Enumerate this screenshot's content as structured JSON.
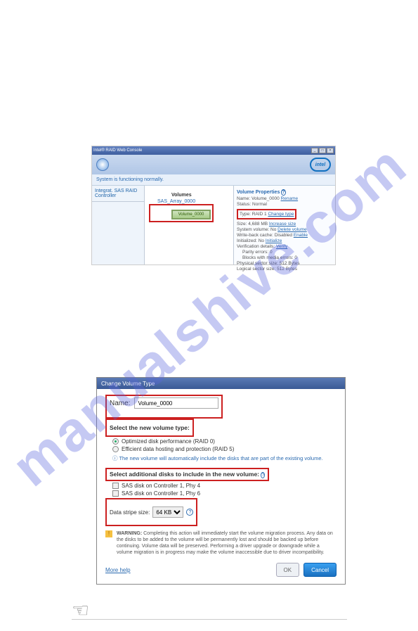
{
  "watermark": "manualshive.com",
  "shot1": {
    "titlebar": "Intel® RAID Web Console",
    "win_min": "_",
    "win_max": "□",
    "win_close": "×",
    "intel_logo": "intel",
    "status": "System is functioning normally.",
    "tab_label": "Integrat. SAS RAID Controller",
    "volumes_header": "Volumes",
    "array_name": "SAS_Array_0000",
    "volume_chip": "Volume_0000",
    "props_title": "Volume Properties",
    "name_line": "Name: Volume_0000",
    "name_link": "Rename",
    "status_line": "Status: Normal",
    "type_line": "Type: RAID 1",
    "type_link": "Change type",
    "size_line": "Size: 4,688 MB",
    "size_link": "Increase size",
    "sysvol_line": "System volume: No",
    "sysvol_link": "Delete volume",
    "wbc_line": "Write-back cache: Disabled",
    "wbc_link": "Enable",
    "init_line": "Initialized: No",
    "init_link": "Initialize",
    "verify_line": "Verification details:",
    "verify_link": "Verify",
    "parity_line": "Parity errors: 0",
    "blocks_line": "Blocks with media errors: 0",
    "physsec_line": "Physical sector size: 512 Bytes",
    "logsec_line": "Logical sector size: 512 Bytes"
  },
  "dlg": {
    "title": "Change Volume Type",
    "name_label": "Name:",
    "name_value": "Volume_0000",
    "sec_newtype": "Select the new volume type:",
    "opt_raid0": "Optimized disk performance (RAID 0)",
    "opt_raid5": "Efficient data hosting and protection (RAID 5)",
    "note_autodisks": "The new volume will automatically include the disks that are part of the existing volume.",
    "sec_adddisks": "Select additional disks to include in the new volume:",
    "disk1": "SAS disk on Controller 1, Phy 4",
    "disk2": "SAS disk on Controller 1, Phy 6",
    "stripe_label": "Data stripe size:",
    "stripe_value": "64 KB",
    "warn_label": "WARNING:",
    "warn_text": "Completing this action will immediately start the volume migration process. Any data on the disks to be added to the volume will be permanently lost and should be backed up before continuing. Volume data will be preserved. Performing a driver upgrade or downgrade while a volume migration is in progress may make the volume inaccessible due to driver incompatibility.",
    "more_help": "More help",
    "ok": "OK",
    "cancel": "Cancel"
  }
}
